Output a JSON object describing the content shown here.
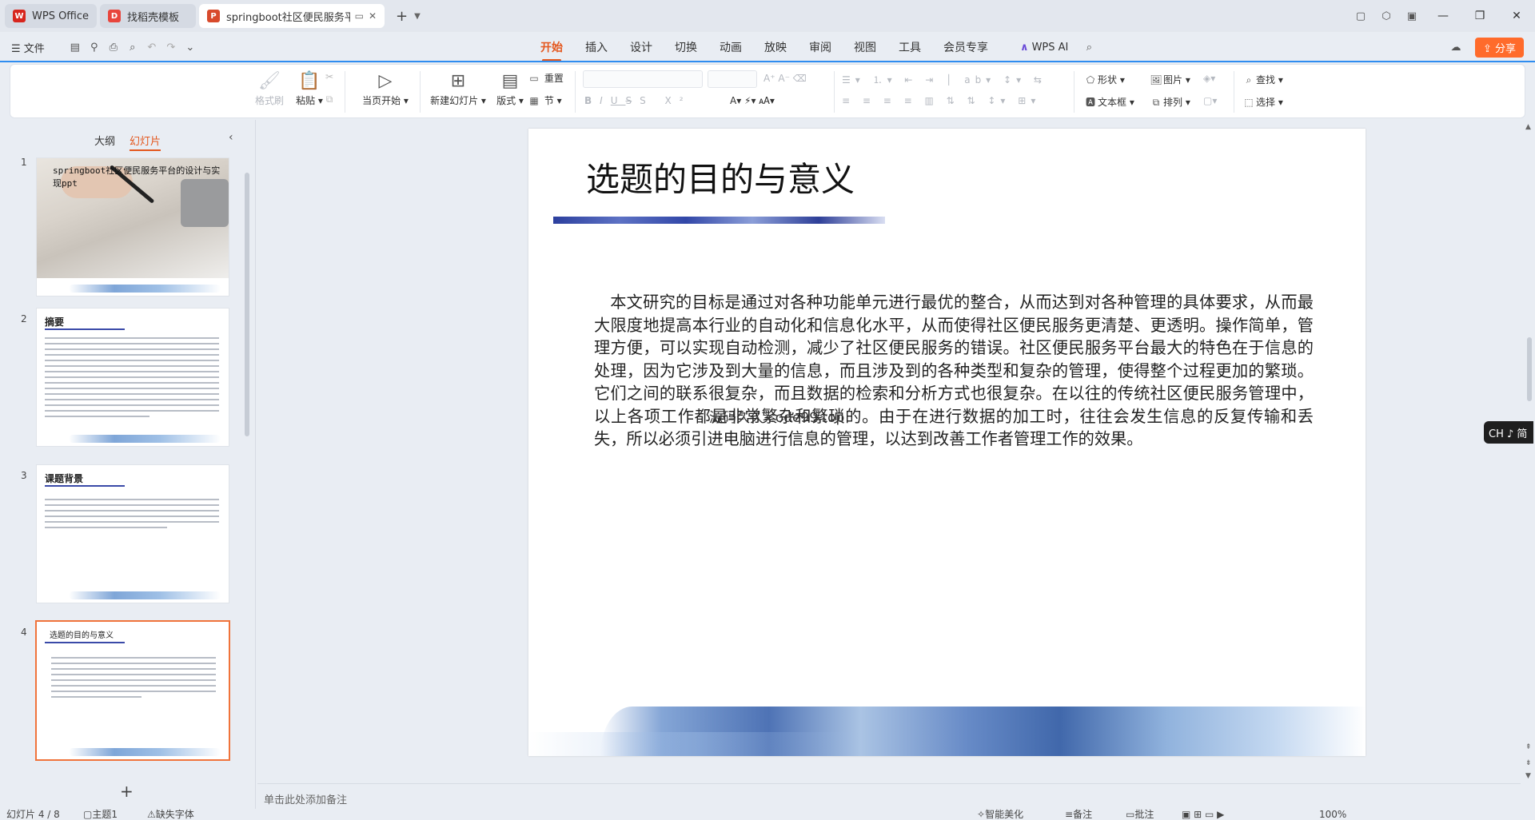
{
  "tabs": [
    {
      "label": "WPS Office",
      "state": "inactive",
      "logo_color": "#d7261e"
    },
    {
      "label": "找稻壳模板",
      "state": "inactive",
      "logo_color": "#e8453c"
    },
    {
      "label": "springboot社区便民服务平",
      "state": "active",
      "logo_color": "#d84a2c"
    }
  ],
  "menu": {
    "file": "文件",
    "tabs": [
      "开始",
      "插入",
      "设计",
      "切换",
      "动画",
      "放映",
      "审阅",
      "视图",
      "工具",
      "会员专享"
    ],
    "active_tab": "开始",
    "wps_ai": "WPS AI",
    "share": "分享"
  },
  "ribbon": {
    "format_painter": "格式刷",
    "paste": "粘贴",
    "start_show": "当页开始",
    "new_slide": "新建幻灯片",
    "layout": "版式",
    "reset": "重置",
    "section": "节",
    "shape": "形状",
    "picture": "图片",
    "textbox": "文本框",
    "arrange": "排列",
    "find": "查找",
    "select": "选择"
  },
  "left_panel": {
    "tabs": [
      "大纲",
      "幻灯片"
    ],
    "active_tab": "幻灯片",
    "slides": [
      {
        "num": "1",
        "title": "springboot社区便民服务平台的设计与实现ppt"
      },
      {
        "num": "2",
        "title": "摘要"
      },
      {
        "num": "3",
        "title": "课题背景"
      },
      {
        "num": "4",
        "title": "选题的目的与意义"
      }
    ],
    "selected": "4"
  },
  "slide": {
    "title": "选题的目的与意义",
    "body": "本文研究的目标是通过对各种功能单元进行最优的整合，从而达到对各种管理的具体要求，从而最大限度地提高本行业的自动化和信息化水平，从而使得社区便民服务更清楚、更透明。操作简单，管理方便，可以实现自动检测，减少了社区便民服务的错误。社区便民服务平台最大的特色在于信息的处理，因为它涉及到大量的信息，而且涉及到的各种类型和复杂的管理，使得整个过程更加的繁琐。它们之间的联系很复杂，而且数据的检索和分析方式也很复杂。在以往的传统社区便民服务管理中，以上各项工作都是非常繁杂和繁琐的。由于在进行数据的加工时，往往会发生信息的反复传输和丢失，所以必须引进电脑进行信息的管理，以达到改善工作者管理工作的效果。",
    "watermark": "源码久久 code99.top"
  },
  "notes_placeholder": "单击此处添加备注",
  "ime": "CH ♪ 简",
  "status": {
    "slide_info": "幻灯片 4 / 8",
    "theme": "主题1",
    "font_missing": "缺失字体",
    "smart_beautify": "智能美化",
    "notes": "备注",
    "comments": "批注",
    "zoom": "100%"
  }
}
